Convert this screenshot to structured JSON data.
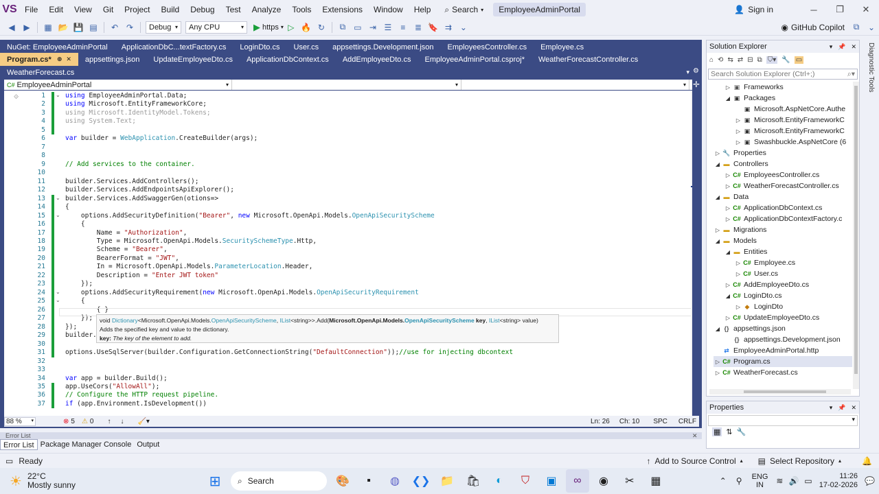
{
  "app": {
    "logo": "VS"
  },
  "menu": [
    "File",
    "Edit",
    "View",
    "Git",
    "Project",
    "Build",
    "Debug",
    "Test",
    "Analyze",
    "Tools",
    "Extensions",
    "Window",
    "Help"
  ],
  "search_label": "Search",
  "title": "EmployeeAdminPortal",
  "signin": "Sign in",
  "toolbar": {
    "config": "Debug",
    "platform": "Any CPU",
    "run_target": "https",
    "copilot": "GitHub Copilot"
  },
  "tabs_row1": [
    {
      "label": "NuGet: EmployeeAdminPortal"
    },
    {
      "label": "ApplicationDbC...textFactory.cs"
    },
    {
      "label": "LoginDto.cs"
    },
    {
      "label": "User.cs"
    },
    {
      "label": "appsettings.Development.json"
    },
    {
      "label": "EmployeesController.cs"
    },
    {
      "label": "Employee.cs"
    }
  ],
  "tabs_row2": [
    {
      "label": "Program.cs*",
      "active": true
    },
    {
      "label": "appsettings.json"
    },
    {
      "label": "UpdateEmployeeDto.cs"
    },
    {
      "label": "ApplicationDbContext.cs"
    },
    {
      "label": "AddEmployeeDto.cs"
    },
    {
      "label": "EmployeeAdminPortal.csproj*"
    },
    {
      "label": "WeatherForecastController.cs"
    }
  ],
  "tabs_row3": [
    {
      "label": "WeatherForecast.cs"
    }
  ],
  "navbar": {
    "project": "EmployeeAdminPortal"
  },
  "code_lines": [
    {
      "n": "1",
      "html": "<span class='kw'>using</span> EmployeeAdminPortal.Data;"
    },
    {
      "n": "2",
      "html": "<span class='kw'>using</span> Microsoft.EntityFrameworkCore;"
    },
    {
      "n": "3",
      "html": "<span class='gr'>using Microsoft.IdentityModel.Tokens;</span>"
    },
    {
      "n": "4",
      "html": "<span class='gr'>using System.Text;</span>"
    },
    {
      "n": "5",
      "html": ""
    },
    {
      "n": "6",
      "html": "<span class='kw'>var</span> builder = <span class='ty'>WebApplication</span>.CreateBuilder(args);"
    },
    {
      "n": "7",
      "html": ""
    },
    {
      "n": "8",
      "html": ""
    },
    {
      "n": "9",
      "html": "<span class='cm'>// Add services to the container.</span>"
    },
    {
      "n": "10",
      "html": ""
    },
    {
      "n": "11",
      "html": "builder.Services.AddControllers();"
    },
    {
      "n": "12",
      "html": "builder.Services.AddEndpointsApiExplorer();"
    },
    {
      "n": "13",
      "html": "builder.Services.AddSwaggerGen(otions=>"
    },
    {
      "n": "14",
      "html": "{"
    },
    {
      "n": "15",
      "html": "    options.AddSecurityDefinition(<span class='str'>\"Bearer\"</span>, <span class='kw'>new</span> Microsoft.OpenApi.Models.<span class='ty'>OpenApiSecurityScheme</span>"
    },
    {
      "n": "16",
      "html": "    {"
    },
    {
      "n": "17",
      "html": "        Name = <span class='str'>\"Authorization\"</span>,"
    },
    {
      "n": "18",
      "html": "        Type = Microsoft.OpenApi.Models.<span class='ty'>SecuritySchemeType</span>.Http,"
    },
    {
      "n": "19",
      "html": "        Scheme = <span class='str'>\"Bearer\"</span>,"
    },
    {
      "n": "20",
      "html": "        BearerFormat = <span class='str'>\"JWT\"</span>,"
    },
    {
      "n": "21",
      "html": "        In = Microsoft.OpenApi.Models.<span class='ty'>ParameterLocation</span>.Header,"
    },
    {
      "n": "22",
      "html": "        Description = <span class='str'>\"Enter JWT token\"</span>"
    },
    {
      "n": "23",
      "html": "    });"
    },
    {
      "n": "24",
      "html": "    options.AddSecurityRequirement(<span class='kw'>new</span> Microsoft.OpenApi.Models.<span class='ty'>OpenApiSecurityRequirement</span>"
    },
    {
      "n": "25",
      "html": "    {"
    },
    {
      "n": "26",
      "html": "        { }"
    },
    {
      "n": "27",
      "html": "    });"
    },
    {
      "n": "28",
      "html": "});"
    },
    {
      "n": "29",
      "html": "builder.Services.AddDbContext&lt;ApplicationDbContext&gt;(options =&gt;"
    },
    {
      "n": "30",
      "html": ""
    },
    {
      "n": "31",
      "html": "options.UseSqlServer(builder.Configuration.GetConnectionString(<span class='str'>\"DefaultConnection\"</span>));<span class='cm'>//use for injecting dbcontext</span>"
    },
    {
      "n": "32",
      "html": ""
    },
    {
      "n": "33",
      "html": ""
    },
    {
      "n": "34",
      "html": "<span class='kw'>var</span> app = builder.Build();"
    },
    {
      "n": "35",
      "html": "app.UseCors(<span class='str'>\"AllowAll\"</span>);"
    },
    {
      "n": "36",
      "html": "<span class='cm'>// Configure the HTTP request pipeline.</span>"
    },
    {
      "n": "37",
      "html": "<span class='kw'>if</span> (app.Environment.IsDevelopment())"
    }
  ],
  "tooltip": {
    "signature": "void Dictionary<Microsoft.OpenApi.Models.OpenApiSecurityScheme, IList<string>>.Add(Microsoft.OpenApi.Models.OpenApiSecurityScheme key, IList<string> value)",
    "summary": "Adds the specified key and value to the dictionary.",
    "param_name": "key:",
    "param_desc": "The key of the element to add."
  },
  "editor_status": {
    "zoom": "88 %",
    "errors": "5",
    "warnings": "0",
    "ln": "Ln: 26",
    "ch": "Ch: 10",
    "spc": "SPC",
    "eol": "CRLF"
  },
  "error_strip": "Error List",
  "bottom_tabs": [
    "Error List",
    "Package Manager Console",
    "Output"
  ],
  "status": {
    "ready": "Ready",
    "source_control": "Add to Source Control",
    "repo": "Select Repository"
  },
  "solution_explorer": {
    "title": "Solution Explorer",
    "search_placeholder": "Search Solution Explorer (Ctrl+;)",
    "tree": [
      {
        "label": "Frameworks",
        "indent": 3,
        "tw": "▷",
        "icon": "fw"
      },
      {
        "label": "Packages",
        "indent": 3,
        "tw": "◢",
        "icon": "pkg"
      },
      {
        "label": "Microsoft.AspNetCore.Authe",
        "indent": 4,
        "tw": "",
        "icon": "pkg"
      },
      {
        "label": "Microsoft.EntityFrameworkC",
        "indent": 4,
        "tw": "▷",
        "icon": "pkg"
      },
      {
        "label": "Microsoft.EntityFrameworkC",
        "indent": 4,
        "tw": "▷",
        "icon": "pkg"
      },
      {
        "label": "Swashbuckle.AspNetCore (6",
        "indent": 4,
        "tw": "▷",
        "icon": "pkg"
      },
      {
        "label": "Properties",
        "indent": 2,
        "tw": "▷",
        "icon": "prop"
      },
      {
        "label": "Controllers",
        "indent": 2,
        "tw": "◢",
        "icon": "folder"
      },
      {
        "label": "EmployeesController.cs",
        "indent": 3,
        "tw": "▷",
        "icon": "cs"
      },
      {
        "label": "WeatherForecastController.cs",
        "indent": 3,
        "tw": "▷",
        "icon": "cs"
      },
      {
        "label": "Data",
        "indent": 2,
        "tw": "◢",
        "icon": "folder"
      },
      {
        "label": "ApplicationDbContext.cs",
        "indent": 3,
        "tw": "▷",
        "icon": "cs"
      },
      {
        "label": "ApplicationDbContextFactory.c",
        "indent": 3,
        "tw": "▷",
        "icon": "cs"
      },
      {
        "label": "Migrations",
        "indent": 2,
        "tw": "▷",
        "icon": "folder"
      },
      {
        "label": "Models",
        "indent": 2,
        "tw": "◢",
        "icon": "folder"
      },
      {
        "label": "Entities",
        "indent": 3,
        "tw": "◢",
        "icon": "folder"
      },
      {
        "label": "Employee.cs",
        "indent": 4,
        "tw": "▷",
        "icon": "cs"
      },
      {
        "label": "User.cs",
        "indent": 4,
        "tw": "▷",
        "icon": "cs"
      },
      {
        "label": "AddEmployeeDto.cs",
        "indent": 3,
        "tw": "▷",
        "icon": "cs"
      },
      {
        "label": "LoginDto.cs",
        "indent": 3,
        "tw": "◢",
        "icon": "cs"
      },
      {
        "label": "LoginDto",
        "indent": 4,
        "tw": "▷",
        "icon": "cls"
      },
      {
        "label": "UpdateEmployeeDto.cs",
        "indent": 3,
        "tw": "▷",
        "icon": "cs"
      },
      {
        "label": "appsettings.json",
        "indent": 2,
        "tw": "◢",
        "icon": "json"
      },
      {
        "label": "appsettings.Development.json",
        "indent": 3,
        "tw": "",
        "icon": "json"
      },
      {
        "label": "EmployeeAdminPortal.http",
        "indent": 2,
        "tw": "",
        "icon": "http"
      },
      {
        "label": "Program.cs",
        "indent": 2,
        "tw": "▷",
        "icon": "cs",
        "selected": true
      },
      {
        "label": "WeatherForecast.cs",
        "indent": 2,
        "tw": "▷",
        "icon": "cs"
      }
    ]
  },
  "properties": {
    "title": "Properties"
  },
  "diagnostic_tools": "Diagnostic Tools",
  "taskbar": {
    "weather_temp": "22°C",
    "weather_desc": "Mostly sunny",
    "search": "Search",
    "lang1": "ENG",
    "lang2": "IN",
    "time": "11:26",
    "date": "17-02-2026"
  },
  "colors": {
    "accent": "#3b4b84",
    "active_tab": "#f5cc84",
    "keyword": "#0000ff",
    "type": "#2b91af",
    "string": "#a31515",
    "comment": "#008000"
  }
}
